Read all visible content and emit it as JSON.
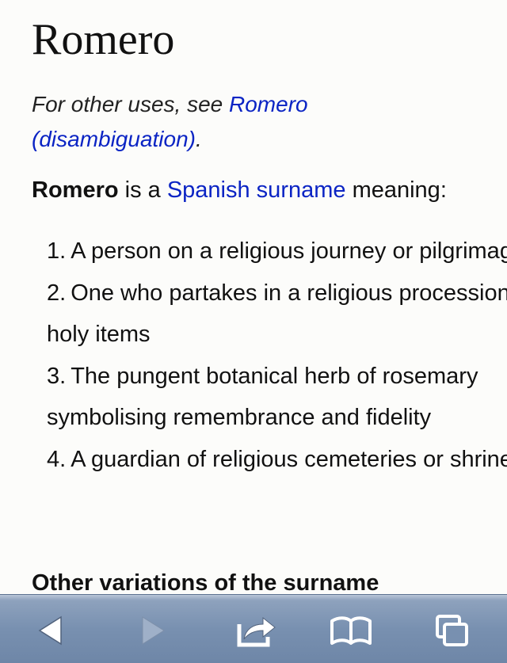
{
  "article": {
    "title": "Romero",
    "hatnote": {
      "prefix": "For other uses, see ",
      "link": "Romero (disambiguation)",
      "suffix": "."
    },
    "intro": {
      "bold": "Romero",
      "mid": " is a ",
      "link": "Spanish surname",
      "suffix": " meaning:"
    },
    "meanings": [
      {
        "num": "1.",
        "text": "A person on a religious journey or pilgrimage"
      },
      {
        "num": "2.",
        "text": "One who partakes in a religious procession of holy items"
      },
      {
        "num": "3.",
        "text": "The pungent botanical herb of rosemary symbolising remembrance and fidelity"
      },
      {
        "num": "4.",
        "text": "A guardian of religious cemeteries or shrines"
      }
    ],
    "subheading": "Other variations of the surname"
  },
  "toolbar": {
    "buttons": [
      {
        "icon": "back-arrow-icon",
        "enabled": true
      },
      {
        "icon": "forward-arrow-icon",
        "enabled": false
      },
      {
        "icon": "share-icon",
        "enabled": true
      },
      {
        "icon": "bookmarks-icon",
        "enabled": true
      },
      {
        "icon": "tabs-icon",
        "enabled": true
      }
    ],
    "colors": {
      "bar": "#7890b0",
      "icon": "#ffffff",
      "disabled_icon": "#9fb0c8"
    }
  },
  "colors": {
    "link": "#0b24c4",
    "text": "#111111",
    "background": "#fcfcfa"
  }
}
